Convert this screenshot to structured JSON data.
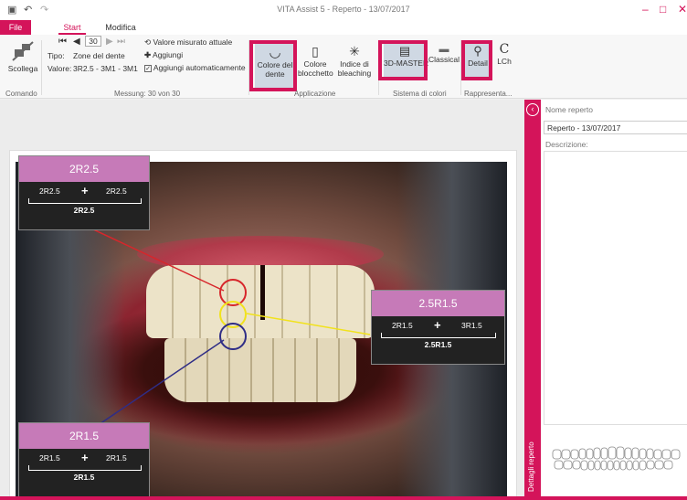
{
  "app": {
    "title": "VITA Assist 5 - Reperto - 13/07/2017"
  },
  "tabs": {
    "file": "File",
    "start": "Start",
    "modifica": "Modifica"
  },
  "ribbon": {
    "comando": {
      "button": "Scollega",
      "group": "Comando"
    },
    "messung": {
      "tipo_label": "Tipo:",
      "tipo_value": "Zone del dente",
      "valore_label": "Valore:",
      "valore_value": "3R2.5 - 3M1 - 3M1",
      "page_value": "30",
      "valore_misurato": "Valore misurato attuale",
      "aggiungi": "Aggiungi",
      "aggiungi_auto": "Aggiungi automaticamente",
      "group": "Messung: 30 von 30"
    },
    "applicazione": {
      "colore_dente": "Colore del dente",
      "colore_blocchetto": "Colore blocchetto",
      "indice_bleaching": "Indice di bleaching",
      "group": "Applicazione"
    },
    "sistema": {
      "master": "3D-MASTER",
      "classical": "Classical",
      "group": "Sistema di colori"
    },
    "rappresenta": {
      "detail": "Detail",
      "lch": "LCh",
      "group": "Rappresenta..."
    }
  },
  "shades": [
    {
      "header": "2R2.5",
      "left": "2R2.5",
      "right": "2R2.5",
      "result": "2R2.5",
      "color": "#d7262b"
    },
    {
      "header": "2.5R1.5",
      "left": "2R1.5",
      "right": "3R1.5",
      "result": "2.5R1.5",
      "color": "#f1e21c"
    },
    {
      "header": "2R1.5",
      "left": "2R1.5",
      "right": "2R1.5",
      "result": "2R1.5",
      "color": "#2f2d86"
    }
  ],
  "plus": "+",
  "side": {
    "nome_label": "Nome reperto",
    "nome_value": "Reperto - 13/07/2017",
    "descrizione_label": "Descrizione:",
    "strip_label": "Dettagli reperto"
  },
  "colors": {
    "accent": "#d4145a"
  }
}
